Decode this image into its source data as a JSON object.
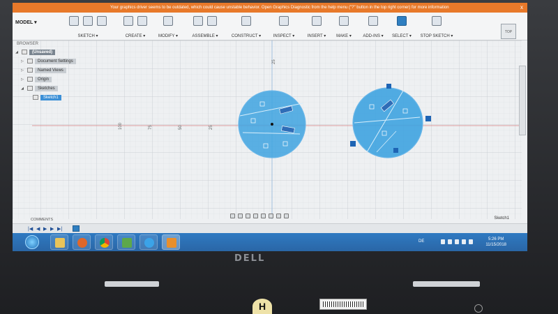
{
  "warning": {
    "text": "Your graphics driver seems to be outdated, which could cause unstable behavior. Open Graphics Diagnostic from the help menu (\"?\" button in the top right corner) for more information",
    "close": "x"
  },
  "toolbar": {
    "workspace": "MODEL ▾",
    "groups": [
      "SKETCH ▾",
      "CREATE ▾",
      "MODIFY ▾",
      "ASSEMBLE ▾",
      "CONSTRUCT ▾",
      "INSPECT ▾",
      "INSERT ▾",
      "MAKE ▾",
      "ADD-INS ▾",
      "SELECT ▾",
      "STOP SKETCH ▾"
    ]
  },
  "browser": {
    "title": "BROWSER",
    "root": "(Unsaved)",
    "items": [
      "Document Settings",
      "Named Views",
      "Origin",
      "Sketches"
    ],
    "selected": "Sketch1"
  },
  "canvas": {
    "axis_labels": [
      "25",
      "50",
      "75",
      "100",
      "25"
    ],
    "viewcube": "TOP"
  },
  "status": {
    "comments": "COMMENTS",
    "sketch": "Sketch1"
  },
  "taskbar": {
    "lang": "DE",
    "time": "5:26 PM",
    "date": "11/15/2018",
    "apps": [
      "explorer",
      "media",
      "chrome",
      "games",
      "ie",
      "fusion"
    ]
  },
  "hardware": {
    "brand": "DELL",
    "badge": "H"
  },
  "colors": {
    "sketch_fill": "#3ea3e0",
    "warning": "#e8792a",
    "taskbar": "#2f7ac2",
    "accent": "#2f7fc1"
  }
}
